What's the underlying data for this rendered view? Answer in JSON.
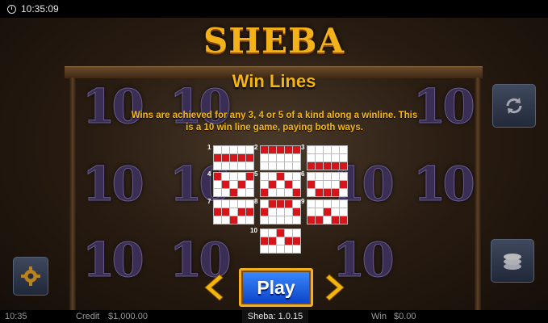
{
  "status_bar": {
    "time": "10:35:09"
  },
  "game": {
    "logo": "SHEBA",
    "title": "Win Lines",
    "description": "Wins are achieved for any 3, 4 or 5 of a kind along a winline. This is a 10 win line game, paying both ways.",
    "play_label": "Play",
    "version": "Sheba: 1.0.15"
  },
  "bottom_bar": {
    "clock": "10:35",
    "credit_label": "Credit",
    "credit_value": "$1,000.00",
    "win_label": "Win",
    "win_value": "$0.00"
  },
  "reel_symbol": "10",
  "winlines": [
    {
      "number": "1",
      "rows": [
        [
          0,
          0,
          0,
          0,
          0
        ],
        [
          1,
          1,
          1,
          1,
          1
        ],
        [
          0,
          0,
          0,
          0,
          0
        ]
      ]
    },
    {
      "number": "2",
      "rows": [
        [
          1,
          1,
          1,
          1,
          1
        ],
        [
          0,
          0,
          0,
          0,
          0
        ],
        [
          0,
          0,
          0,
          0,
          0
        ]
      ]
    },
    {
      "number": "3",
      "rows": [
        [
          0,
          0,
          0,
          0,
          0
        ],
        [
          0,
          0,
          0,
          0,
          0
        ],
        [
          1,
          1,
          1,
          1,
          1
        ]
      ]
    },
    {
      "number": "4",
      "rows": [
        [
          1,
          0,
          0,
          0,
          1
        ],
        [
          0,
          1,
          0,
          1,
          0
        ],
        [
          0,
          0,
          1,
          0,
          0
        ]
      ]
    },
    {
      "number": "5",
      "rows": [
        [
          0,
          0,
          1,
          0,
          0
        ],
        [
          0,
          1,
          0,
          1,
          0
        ],
        [
          1,
          0,
          0,
          0,
          1
        ]
      ]
    },
    {
      "number": "6",
      "rows": [
        [
          0,
          0,
          0,
          0,
          0
        ],
        [
          1,
          0,
          0,
          0,
          1
        ],
        [
          0,
          1,
          1,
          1,
          0
        ]
      ]
    },
    {
      "number": "7",
      "rows": [
        [
          0,
          0,
          0,
          0,
          0
        ],
        [
          1,
          1,
          0,
          1,
          1
        ],
        [
          0,
          0,
          1,
          0,
          0
        ]
      ]
    },
    {
      "number": "8",
      "rows": [
        [
          0,
          1,
          1,
          1,
          0
        ],
        [
          1,
          0,
          0,
          0,
          1
        ],
        [
          0,
          0,
          0,
          0,
          0
        ]
      ]
    },
    {
      "number": "9",
      "rows": [
        [
          0,
          0,
          0,
          0,
          0
        ],
        [
          0,
          0,
          1,
          0,
          0
        ],
        [
          1,
          1,
          0,
          1,
          1
        ]
      ]
    },
    {
      "number": "10",
      "rows": [
        [
          0,
          0,
          1,
          0,
          0
        ],
        [
          1,
          1,
          0,
          1,
          1
        ],
        [
          0,
          0,
          0,
          0,
          0
        ]
      ]
    }
  ],
  "colors": {
    "accent_gold": "#f5b50f",
    "winline_red": "#d8141b",
    "play_blue": "#1a5ae0"
  },
  "icons": {
    "settings": "gear-icon",
    "autoplay": "refresh-icon",
    "bet": "coin-stack-icon",
    "prev": "chevron-left-icon",
    "next": "chevron-right-icon"
  }
}
